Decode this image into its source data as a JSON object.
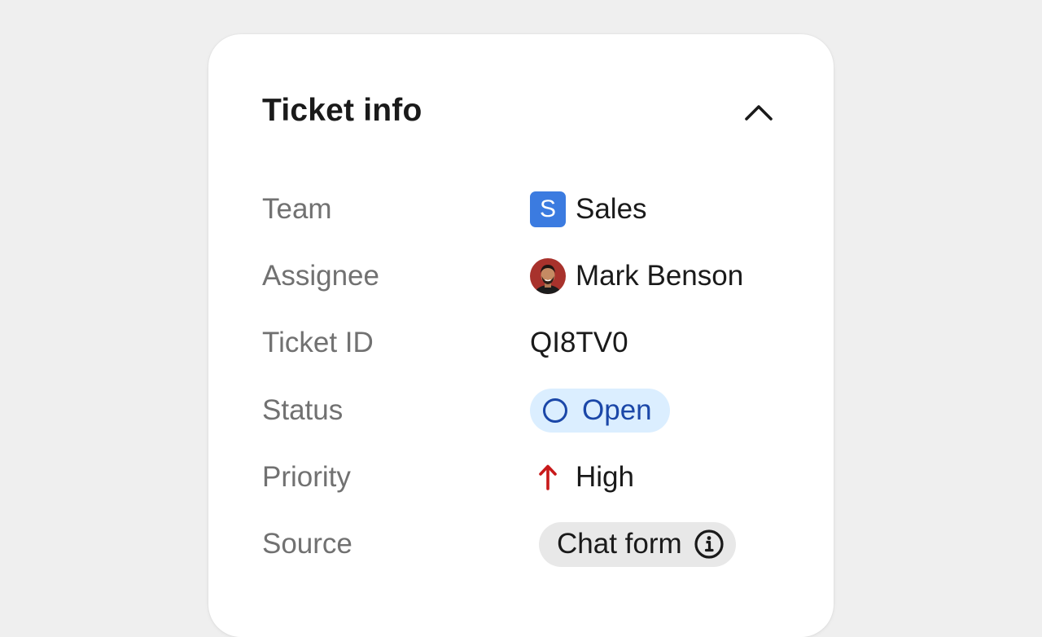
{
  "card": {
    "title": "Ticket info",
    "collapse_icon": "chevron-up-icon"
  },
  "fields": {
    "team": {
      "label": "Team",
      "badge_letter": "S",
      "value": "Sales",
      "badge_color": "#3b7be0"
    },
    "assignee": {
      "label": "Assignee",
      "value": "Mark Benson",
      "avatar_icon": "avatar"
    },
    "ticket_id": {
      "label": "Ticket ID",
      "value": "QI8TV0"
    },
    "status": {
      "label": "Status",
      "value": "Open",
      "icon": "open-circle-icon",
      "pill_color": "#dbeeff",
      "text_color": "#1b47a8"
    },
    "priority": {
      "label": "Priority",
      "value": "High",
      "icon": "arrow-up-icon",
      "icon_color": "#c8191a"
    },
    "source": {
      "label": "Source",
      "value": "Chat form",
      "icon": "info-icon"
    }
  }
}
